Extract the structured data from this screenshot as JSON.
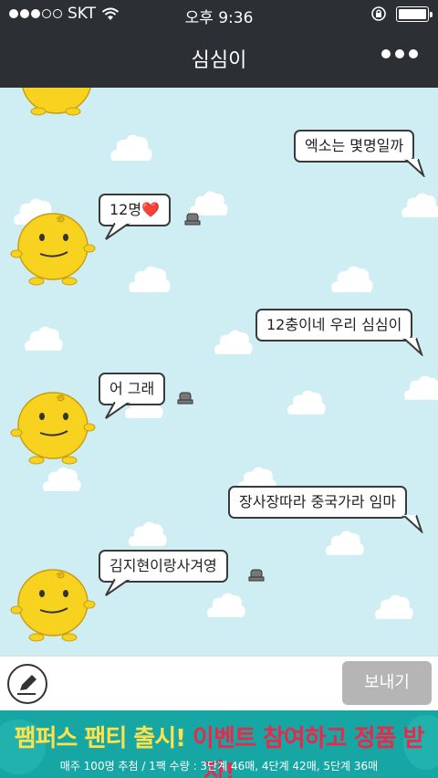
{
  "status_bar": {
    "carrier": "SKT",
    "time": "오후 9:36",
    "signal_bars_filled": 3,
    "signal_bars_total": 5,
    "battery_level": 1.0
  },
  "header": {
    "title": "심심이",
    "more_icon": "ellipsis-icon"
  },
  "messages": [
    {
      "from": "user",
      "text": "엑소는 몇명일까"
    },
    {
      "from": "bot",
      "text": "12명",
      "emoji": "❤️"
    },
    {
      "from": "user",
      "text": "12충이네 우리 심심이"
    },
    {
      "from": "bot",
      "text": "어 그래"
    },
    {
      "from": "user",
      "text": "장사장따라 중국가라 임마"
    },
    {
      "from": "bot",
      "text": "김지현이랑사겨영"
    }
  ],
  "input": {
    "placeholder": "",
    "send_label": "보내기",
    "pen_icon": "pencil-icon"
  },
  "ad_banner": {
    "headline_part1": "팸퍼스 팬티 출시! ",
    "headline_part2": "이벤트 참여하고 정품 받자!",
    "subtext": "매주 100명 추첨 / 1팩 수량 : 3단계 46매, 4단계 42매, 5단계 36매"
  },
  "colors": {
    "header_bg": "#2c2f34",
    "chat_bg": "#cfeef3",
    "send_button": "#b5b5b5",
    "ad_bg": "#16a6a3",
    "ad_yellow": "#ffe14a",
    "ad_red": "#e8294a",
    "simsimi_yellow": "#f7d31f"
  }
}
